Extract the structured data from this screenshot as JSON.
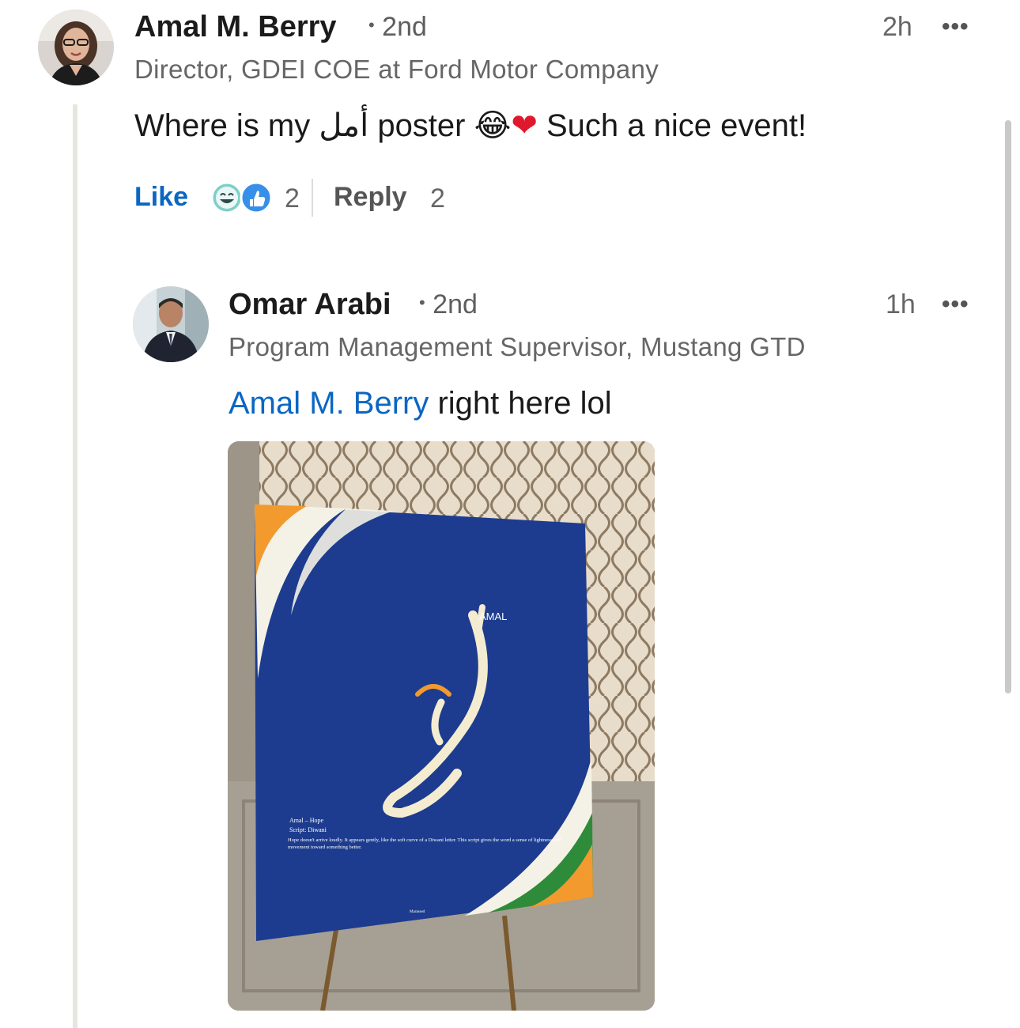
{
  "comment": {
    "author": "Amal M. Berry",
    "degree": "2nd",
    "headline": "Director, GDEI COE at Ford Motor Company",
    "time": "2h",
    "text_before": "Where is my ",
    "arabic_word": "أمل",
    "text_middle": " poster ",
    "emoji_laugh": "😂",
    "emoji_heart": "❤️",
    "text_after": " Such a nice event!",
    "like_label": "Like",
    "reaction_count": "2",
    "reply_label": "Reply",
    "reply_count": "2"
  },
  "reply": {
    "author": "Omar Arabi",
    "degree": "2nd",
    "headline": "Program Management Supervisor, Mustang GTD",
    "time": "1h",
    "mention": "Amal M. Berry",
    "text": " right here lol"
  },
  "poster": {
    "title": "AMAL",
    "calligraphy": "أمل",
    "caption_line1": "Amal – Hope",
    "caption_line2": "Script: Diwani",
    "body": "Hope doesn't arrive loudly. It appears gently, like the soft curve of a Diwani letter. This script gives the word a sense of lightness and movement toward something better.",
    "signature": "Marassed"
  },
  "icons": {
    "more": "more-options-icon",
    "reactions": [
      "laugh-reaction-icon",
      "like-reaction-icon"
    ]
  },
  "colors": {
    "link": "#0a66c2",
    "poster_blue": "#1d3c8f",
    "poster_orange": "#f29a2e",
    "poster_green": "#2e8b3a"
  }
}
